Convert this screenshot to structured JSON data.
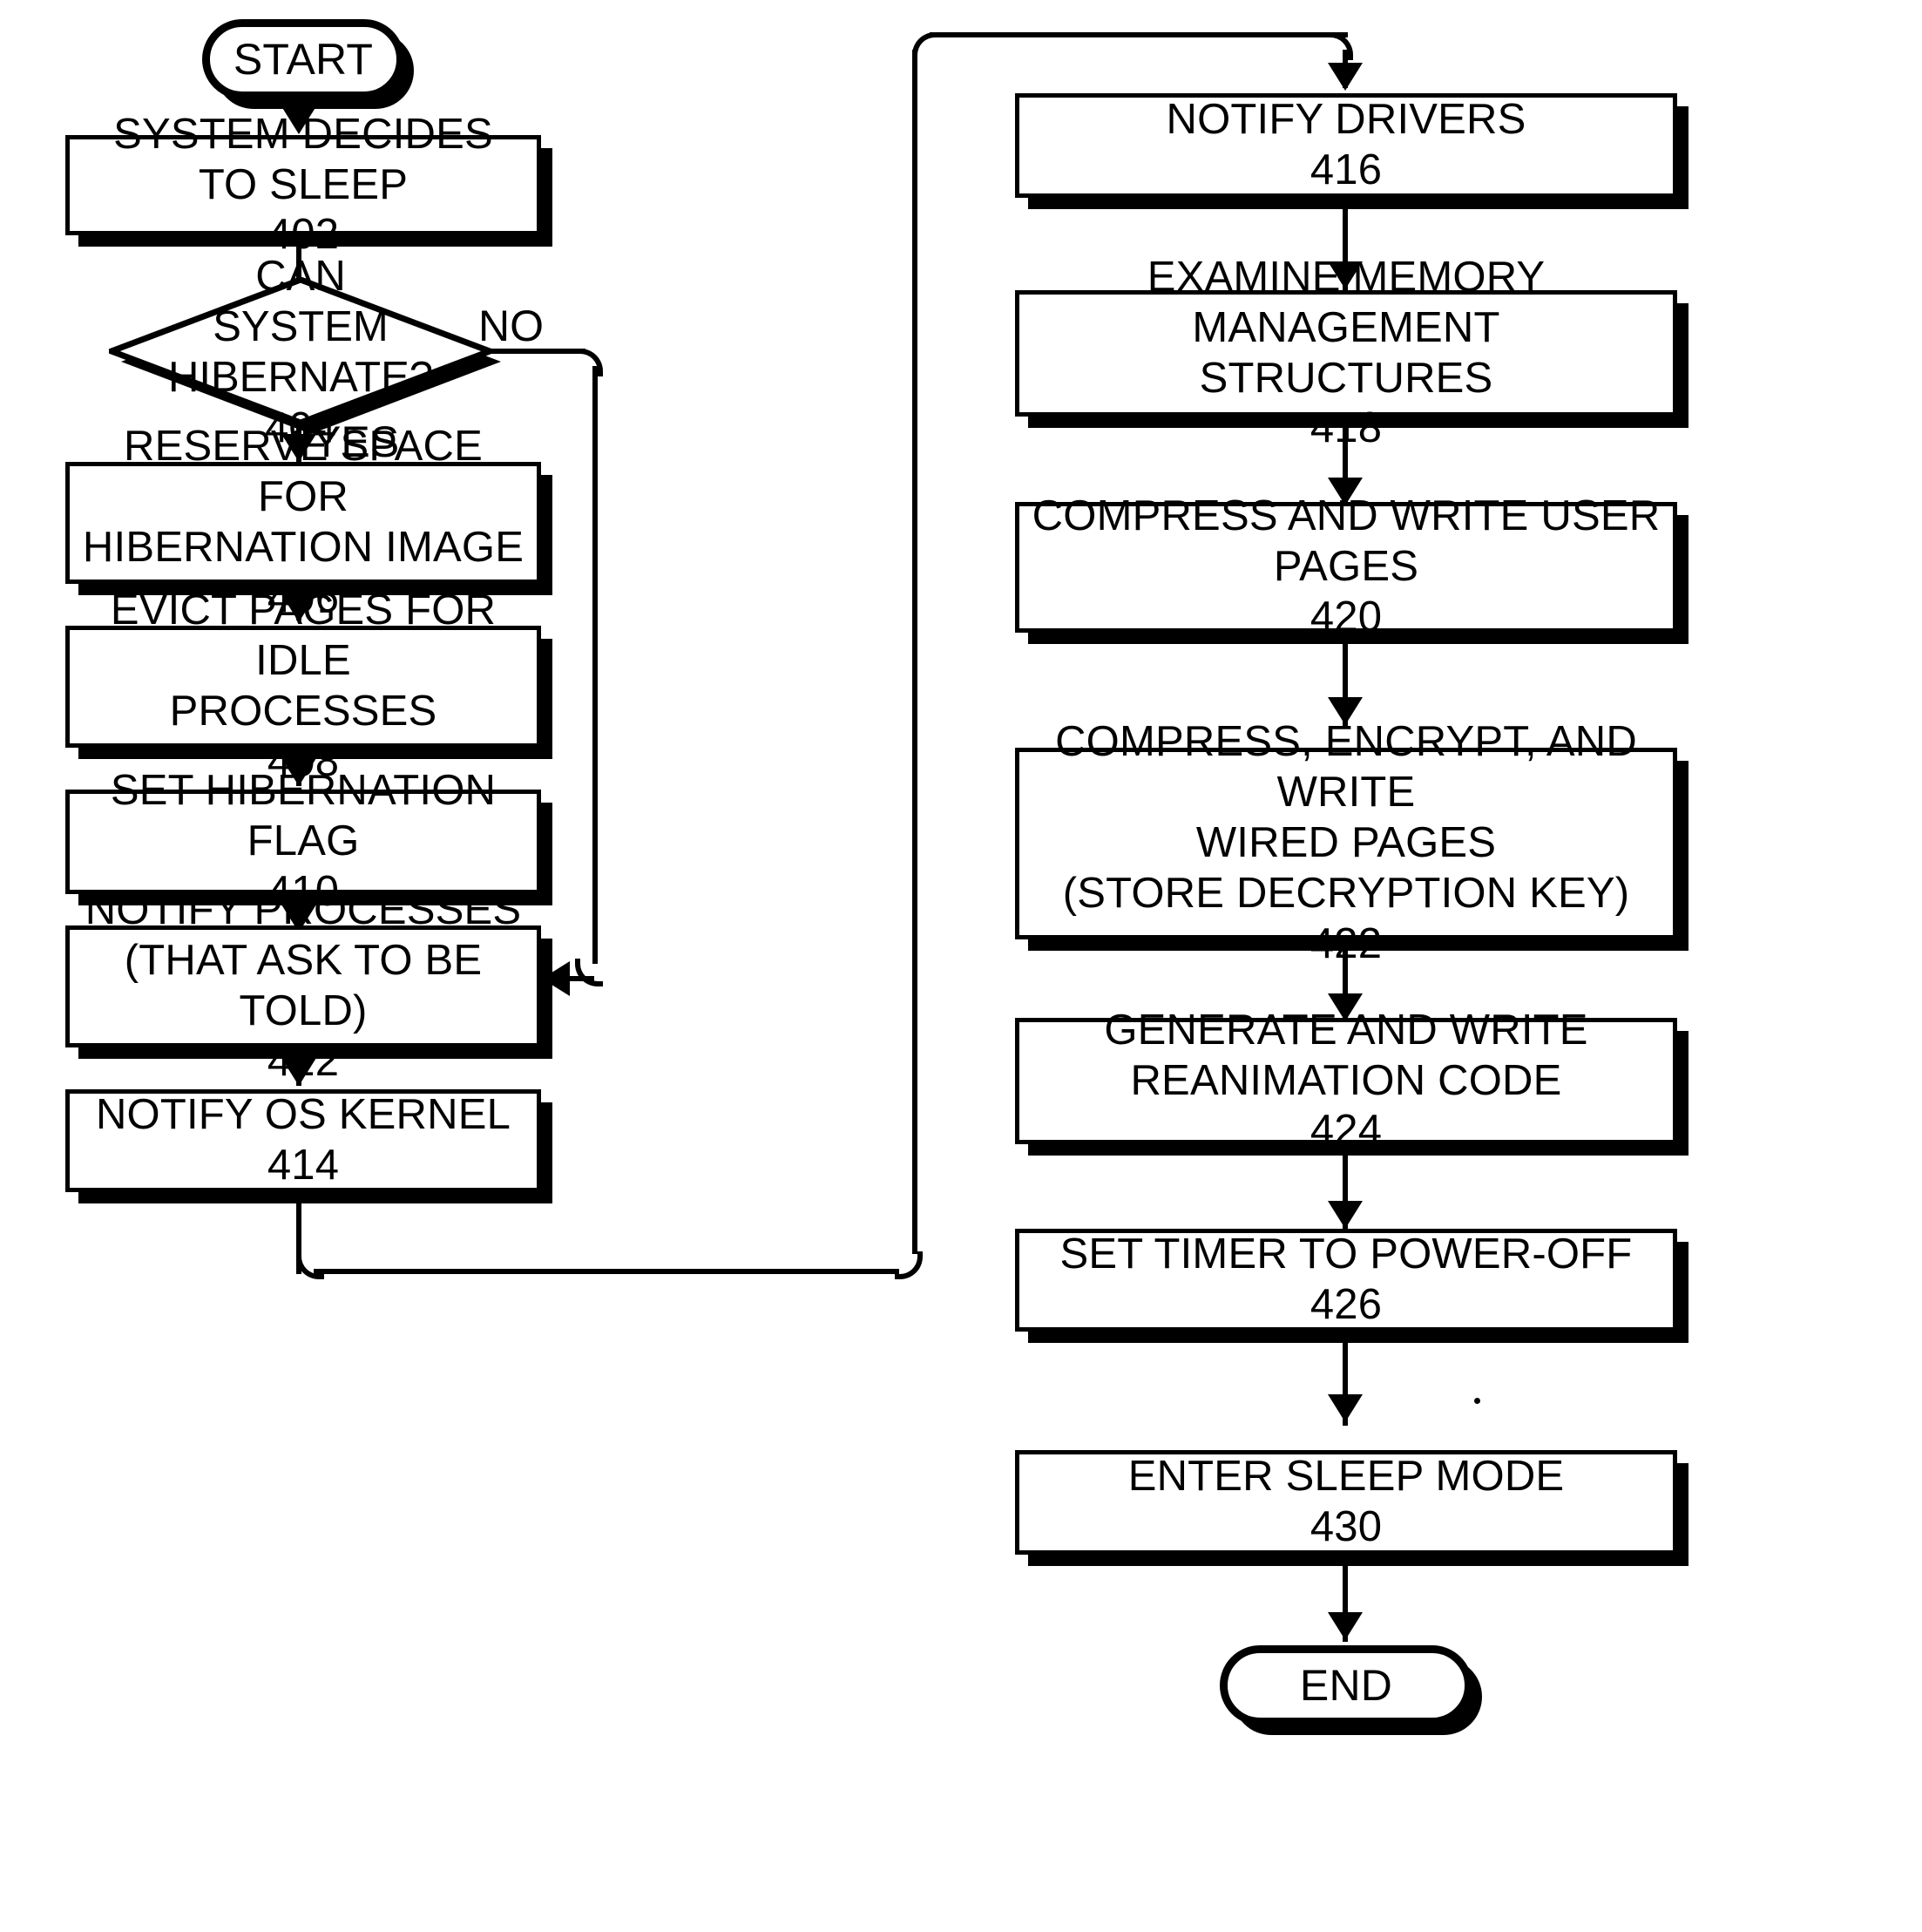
{
  "figure": {
    "kind": "patent-flowchart",
    "background_color": "#ffffff",
    "ink_color": "#000000"
  },
  "nodes": {
    "start": {
      "label": "START",
      "shape": "terminator"
    },
    "end": {
      "label": "END",
      "shape": "terminator"
    },
    "n402": {
      "label": "SYSTEM DECIDES TO SLEEP",
      "ref": "402",
      "shape": "process"
    },
    "n404": {
      "label": "CAN\nSYSTEM HIBERNATE?",
      "ref": "404",
      "shape": "decision"
    },
    "n406": {
      "label": "RESERVE SPACE FOR\nHIBERNATION IMAGE",
      "ref": "406",
      "shape": "process"
    },
    "n408": {
      "label": "EVICT PAGES FOR IDLE\nPROCESSES",
      "ref": "408",
      "shape": "process"
    },
    "n410": {
      "label": "SET HIBERNATION FLAG",
      "ref": "410",
      "shape": "process"
    },
    "n412": {
      "label": "NOTIFY PROCESSES\n(THAT ASK TO BE TOLD)",
      "ref": "412",
      "shape": "process"
    },
    "n414": {
      "label": "NOTIFY OS KERNEL",
      "ref": "414",
      "shape": "process"
    },
    "n416": {
      "label": "NOTIFY DRIVERS",
      "ref": "416",
      "shape": "process"
    },
    "n418": {
      "label": "EXAMINE MEMORY MANAGEMENT\nSTRUCTURES",
      "ref": "418",
      "shape": "process"
    },
    "n420": {
      "label": "COMPRESS AND WRITE USER\nPAGES",
      "ref": "420",
      "shape": "process"
    },
    "n422": {
      "label": "COMPRESS, ENCRYPT, AND WRITE\nWIRED PAGES\n(STORE DECRYPTION KEY)",
      "ref": "422",
      "shape": "process"
    },
    "n424": {
      "label": "GENERATE AND WRITE\nREANIMATION CODE",
      "ref": "424",
      "shape": "process"
    },
    "n426": {
      "label": "SET TIMER TO POWER-OFF",
      "ref": "426",
      "shape": "process"
    },
    "n430": {
      "label": "ENTER SLEEP MODE",
      "ref": "430",
      "shape": "process"
    }
  },
  "edge_labels": {
    "no": "NO",
    "yes": "YES"
  }
}
